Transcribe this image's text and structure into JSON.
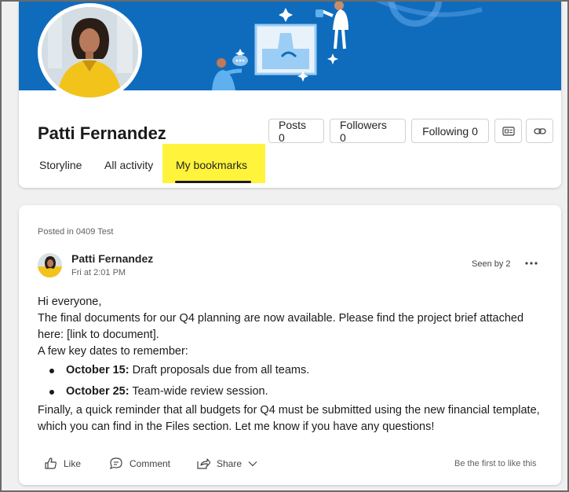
{
  "profile": {
    "name": "Patti Fernandez",
    "stats": [
      {
        "label": "Posts 0"
      },
      {
        "label": "Followers 0"
      },
      {
        "label": "Following 0"
      }
    ],
    "tabs": [
      {
        "label": "Storyline",
        "active": false
      },
      {
        "label": "All activity",
        "active": false
      },
      {
        "label": "My bookmarks",
        "active": true
      }
    ],
    "icons": [
      "contact-card-icon",
      "link-icon"
    ]
  },
  "post": {
    "posted_in": "Posted in 0409 Test",
    "author": "Patti Fernandez",
    "time": "Fri at 2:01 PM",
    "seen_by": "Seen by 2",
    "greeting": "Hi everyone,",
    "paragraph1": "The final documents for our Q4 planning are now available. Please find the project brief attached here: [link to document].",
    "dates_intro": "A few key dates to remember:",
    "bullets": [
      {
        "date": "October 15:",
        "text": " Draft proposals due from all teams."
      },
      {
        "date": "October 25:",
        "text": " Team-wide review session."
      }
    ],
    "paragraph2": "Finally, a quick reminder that all budgets for Q4 must be submitted using the new financial template, which you can find in the Files section. Let me know if you have any questions!",
    "actions": {
      "like": "Like",
      "comment": "Comment",
      "share": "Share"
    },
    "like_prompt": "Be the first to like this"
  },
  "colors": {
    "banner": "#0f6cbd",
    "highlight": "#fff33b",
    "accent_yellow": "#f2c31a"
  }
}
